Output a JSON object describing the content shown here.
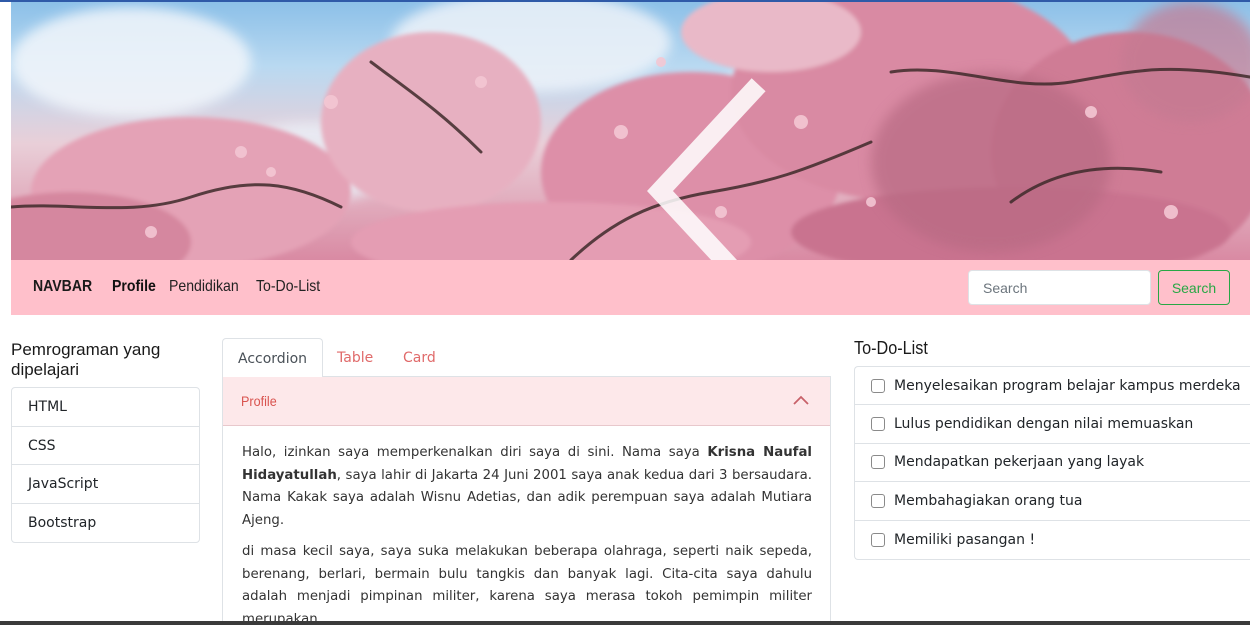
{
  "hero": {
    "prev_icon": "chevron-left-icon",
    "next_icon": "chevron-right-icon"
  },
  "navbar": {
    "brand": "NAVBAR",
    "links": [
      "Profile",
      "Pendidikan",
      "To-Do-List"
    ],
    "background": "#ffc0cb",
    "search_placeholder": "Search",
    "search_button": "Search",
    "search_button_color": "#28a745"
  },
  "sidebar": {
    "title": "Pemrograman yang dipelajari",
    "items": [
      "HTML",
      "CSS",
      "JavaScript",
      "Bootstrap"
    ]
  },
  "tabs": {
    "items": [
      "Accordion",
      "Table",
      "Card"
    ],
    "active": "Accordion",
    "accent": "#e06a6a"
  },
  "accordion": {
    "header": "Profile",
    "expanded": true,
    "p1_a": "Halo, izinkan saya memperkenalkan diri saya di sini. Nama saya ",
    "p1_name": "Krisna Naufal Hidayatullah",
    "p1_b": ", saya lahir di Jakarta 24 Juni 2001 saya anak kedua dari 3 bersaudara. Nama Kakak saya adalah Wisnu Adetias, dan adik perempuan saya adalah Mutiara Ajeng.",
    "p2": "di masa kecil saya, saya suka melakukan beberapa olahraga, seperti naik sepeda, berenang, berlari, bermain bulu tangkis dan banyak lagi. Cita-cita saya dahulu adalah menjadi pimpinan militer, karena saya merasa tokoh pemimpin militer merupakan"
  },
  "todo": {
    "title": "To-Do-List",
    "items": [
      "Menyelesaikan program belajar kampus merdeka",
      "Lulus pendidikan dengan nilai memuaskan",
      "Mendapatkan pekerjaan yang layak",
      "Membahagiakan orang tua",
      "Memiliki pasangan !"
    ]
  }
}
